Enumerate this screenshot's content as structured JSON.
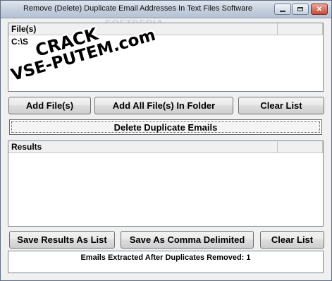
{
  "window": {
    "title": "Remove (Delete) Duplicate Email Addresses In Text Files Software",
    "minimize_label": "",
    "close_label": "✕"
  },
  "files_list": {
    "column_header": "File(s)",
    "rows": [
      "C:\\S"
    ]
  },
  "buttons_row1": {
    "add_files": "Add File(s)",
    "add_all_folder": "Add All File(s) In Folder",
    "clear_list": "Clear List"
  },
  "delete_button": "Delete Duplicate Emails",
  "results_list": {
    "column_header": "Results",
    "rows": []
  },
  "buttons_row2": {
    "save_list": "Save Results As List",
    "save_comma": "Save As Comma Delimited",
    "clear_list": "Clear List"
  },
  "status": {
    "text": "Emails Extracted After Duplicates Removed: 1"
  },
  "watermark": "SOFTPEDIA",
  "overlay": {
    "line1": "CRACK",
    "line2": "VSE-PUTEM.com"
  },
  "colors": {
    "title_gradient": "#c4cfdd",
    "close_button": "#c64c3b",
    "window_bg": "#f0f0f0"
  }
}
